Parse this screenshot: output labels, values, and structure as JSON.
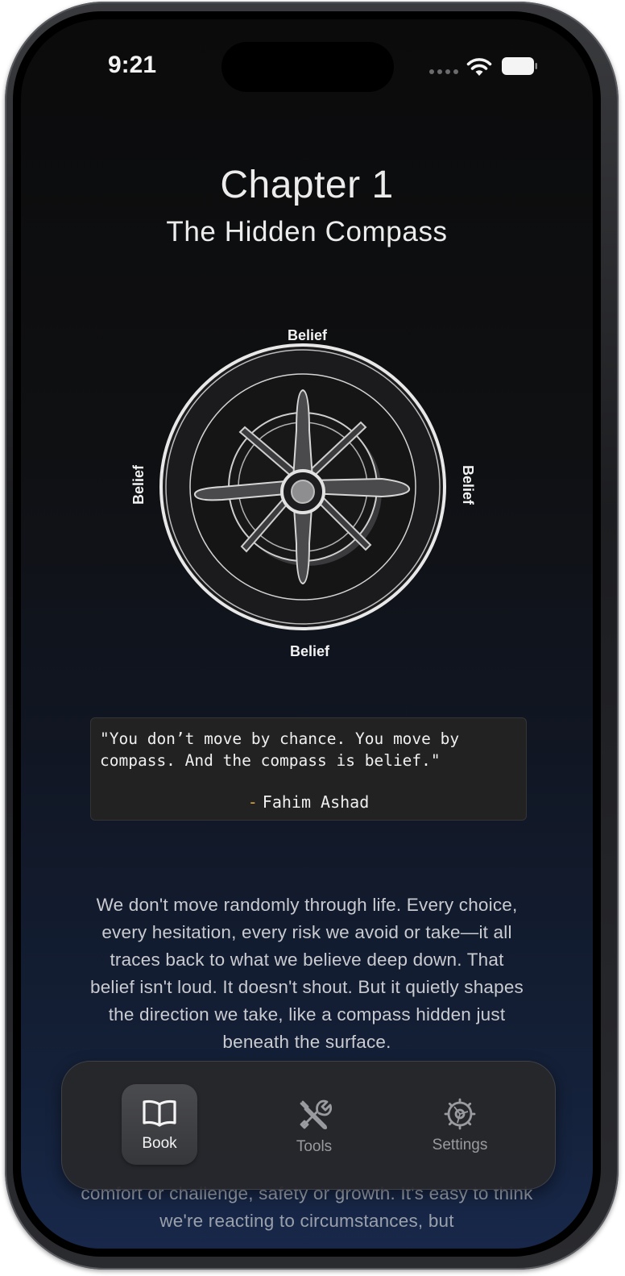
{
  "status_bar": {
    "time": "9:21",
    "icons": [
      "cellular-dots-icon",
      "wifi-icon",
      "battery-icon"
    ]
  },
  "chapter": {
    "title": "Chapter 1",
    "subtitle": "The Hidden Compass"
  },
  "compass": {
    "labels": {
      "top": "Belief",
      "bottom": "Belief",
      "left": "Belief",
      "right": "Belief"
    }
  },
  "quote": {
    "text": "\"You don’t move by chance. You move by compass. And the compass is belief.\"",
    "dash": "-",
    "author": "Fahim Ashad"
  },
  "body": {
    "paragraph": "We don't move randomly through life. Every choice, every hesitation, every risk we avoid or take—it all traces back to what we believe deep down. That belief isn't loud. It doesn't shout. But it quietly shapes the direction we take, like a compass hidden just beneath the surface.",
    "continuation": "comfort or challenge, safety or growth. It's easy to think we're reacting to circumstances, but"
  },
  "tab_bar": {
    "tabs": [
      {
        "label": "Book",
        "icon": "book-icon",
        "selected": true
      },
      {
        "label": "Tools",
        "icon": "tools-icon",
        "selected": false
      },
      {
        "label": "Settings",
        "icon": "gear-icon",
        "selected": false
      }
    ]
  },
  "colors": {
    "accent_dash": "#d9a43a",
    "text_primary": "#ececec",
    "background_top": "#0b0b0c",
    "background_bottom": "#18284a"
  }
}
